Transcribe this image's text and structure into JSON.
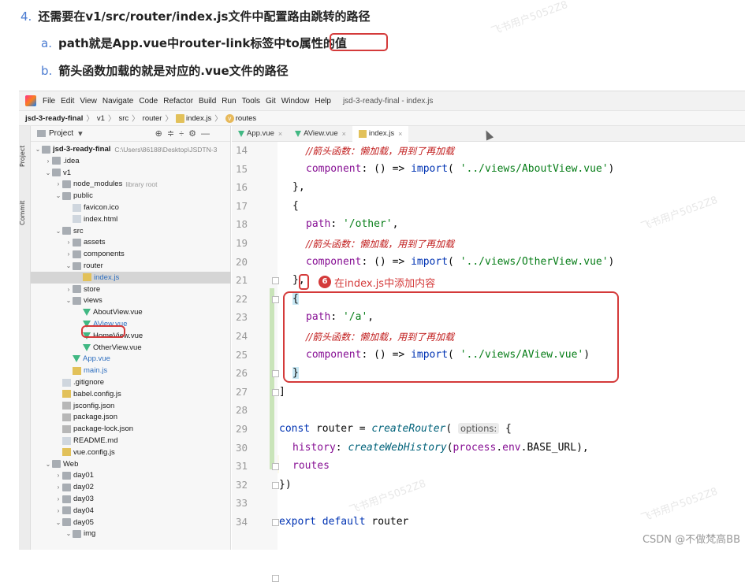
{
  "doc": {
    "step4_num": "4.",
    "step4_text": "还需要在v1/src/router/index.js文件中配置路由跳转的路径",
    "step_a_num": "a.",
    "step_a_text": "path就是App.vue中router-link标签中to属性的值",
    "step_b_num": "b.",
    "step_b_text": "箭头函数加载的就是对应的.vue文件的路径"
  },
  "menubar": {
    "items": [
      "File",
      "Edit",
      "View",
      "Navigate",
      "Code",
      "Refactor",
      "Build",
      "Run",
      "Tools",
      "Git",
      "Window",
      "Help"
    ],
    "window_title": "jsd-3-ready-final - index.js"
  },
  "navbar": {
    "project": "jsd-3-ready-final",
    "p1": "v1",
    "p2": "src",
    "p3": "router",
    "file": "index.js",
    "symbol": "routes"
  },
  "strip": {
    "project": "Project",
    "commit": "Commit"
  },
  "project_panel": {
    "title": "Project",
    "tree": [
      {
        "label": "jsd-3-ready-final",
        "extra": "C:\\Users\\86188\\Desktop\\JSDTN-3",
        "level": 0,
        "icon": "folder",
        "arrow": "down",
        "bold": true
      },
      {
        "label": ".idea",
        "level": 1,
        "icon": "folder",
        "arrow": "right"
      },
      {
        "label": "v1",
        "level": 1,
        "icon": "folder",
        "arrow": "down"
      },
      {
        "label": "node_modules",
        "lib": "library root",
        "level": 2,
        "icon": "folder",
        "arrow": "right"
      },
      {
        "label": "public",
        "level": 2,
        "icon": "folder",
        "arrow": "down"
      },
      {
        "label": "favicon.ico",
        "level": 3,
        "icon": "file"
      },
      {
        "label": "index.html",
        "level": 3,
        "icon": "file"
      },
      {
        "label": "src",
        "level": 2,
        "icon": "folder",
        "arrow": "down"
      },
      {
        "label": "assets",
        "level": 3,
        "icon": "folder",
        "arrow": "right"
      },
      {
        "label": "components",
        "level": 3,
        "icon": "folder",
        "arrow": "right"
      },
      {
        "label": "router",
        "level": 3,
        "icon": "folder",
        "arrow": "down"
      },
      {
        "label": "index.js",
        "level": 4,
        "icon": "js",
        "selected": true,
        "modified": true
      },
      {
        "label": "store",
        "level": 3,
        "icon": "folder",
        "arrow": "right"
      },
      {
        "label": "views",
        "level": 3,
        "icon": "folder",
        "arrow": "down"
      },
      {
        "label": "AboutView.vue",
        "level": 4,
        "icon": "vue"
      },
      {
        "label": "AView.vue",
        "level": 4,
        "icon": "vue",
        "modified": true
      },
      {
        "label": "HomeView.vue",
        "level": 4,
        "icon": "vue"
      },
      {
        "label": "OtherView.vue",
        "level": 4,
        "icon": "vue"
      },
      {
        "label": "App.vue",
        "level": 3,
        "icon": "vue",
        "modified": true
      },
      {
        "label": "main.js",
        "level": 3,
        "icon": "js",
        "modified": true
      },
      {
        "label": ".gitignore",
        "level": 2,
        "icon": "file"
      },
      {
        "label": "babel.config.js",
        "level": 2,
        "icon": "js"
      },
      {
        "label": "jsconfig.json",
        "level": 2,
        "icon": "json"
      },
      {
        "label": "package.json",
        "level": 2,
        "icon": "json"
      },
      {
        "label": "package-lock.json",
        "level": 2,
        "icon": "json"
      },
      {
        "label": "README.md",
        "level": 2,
        "icon": "file"
      },
      {
        "label": "vue.config.js",
        "level": 2,
        "icon": "js"
      },
      {
        "label": "Web",
        "level": 1,
        "icon": "folder",
        "arrow": "down"
      },
      {
        "label": "day01",
        "level": 2,
        "icon": "folder",
        "arrow": "right"
      },
      {
        "label": "day02",
        "level": 2,
        "icon": "folder",
        "arrow": "right"
      },
      {
        "label": "day03",
        "level": 2,
        "icon": "folder",
        "arrow": "right"
      },
      {
        "label": "day04",
        "level": 2,
        "icon": "folder",
        "arrow": "right"
      },
      {
        "label": "day05",
        "level": 2,
        "icon": "folder",
        "arrow": "down"
      },
      {
        "label": "img",
        "level": 3,
        "icon": "folder",
        "arrow": "down"
      }
    ]
  },
  "tabs": [
    {
      "label": "App.vue",
      "icon": "vue"
    },
    {
      "label": "AView.vue",
      "icon": "vue"
    },
    {
      "label": "index.js",
      "icon": "js",
      "active": true
    }
  ],
  "editor": {
    "line_numbers": [
      "14",
      "15",
      "16",
      "17",
      "18",
      "19",
      "20",
      "21",
      "22",
      "23",
      "24",
      "25",
      "26",
      "27",
      "28",
      "29",
      "30",
      "31",
      "32",
      "33",
      "34"
    ],
    "annotation_num": "6",
    "annotation_text": "在index.js中添加内容",
    "hint": "options:"
  },
  "watermark": "飞书用户5052Z8",
  "credit": "CSDN @不做梵高BB"
}
